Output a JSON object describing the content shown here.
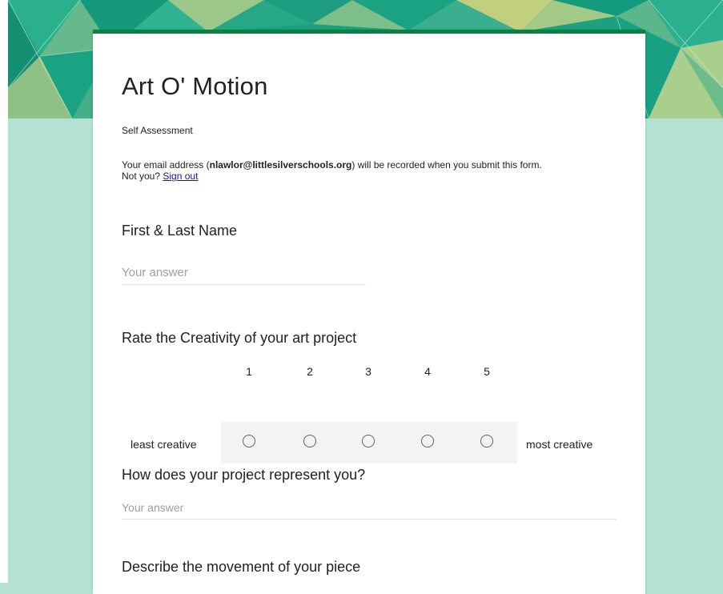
{
  "form": {
    "title": "Art O' Motion",
    "description": "Self Assessment",
    "email_prefix": "Your email address (",
    "email": "nlawlor@littlesilverschools.org",
    "email_suffix": ") will be recorded when you submit this form.",
    "not_you": "Not you?",
    "sign_out": "Sign out"
  },
  "questions": [
    {
      "title": "First & Last Name",
      "placeholder": "Your answer"
    },
    {
      "title": "Rate the Creativity of your art project",
      "scale": [
        "1",
        "2",
        "3",
        "4",
        "5"
      ],
      "min_label": "least creative",
      "max_label": "most creative"
    },
    {
      "title": "How does your project represent you?",
      "placeholder": "Your answer"
    },
    {
      "title": "Describe the movement of your piece"
    }
  ],
  "colors": {
    "background": "#b3e2d5",
    "header_accent": "#0b8043",
    "link": "#1a0dab"
  }
}
